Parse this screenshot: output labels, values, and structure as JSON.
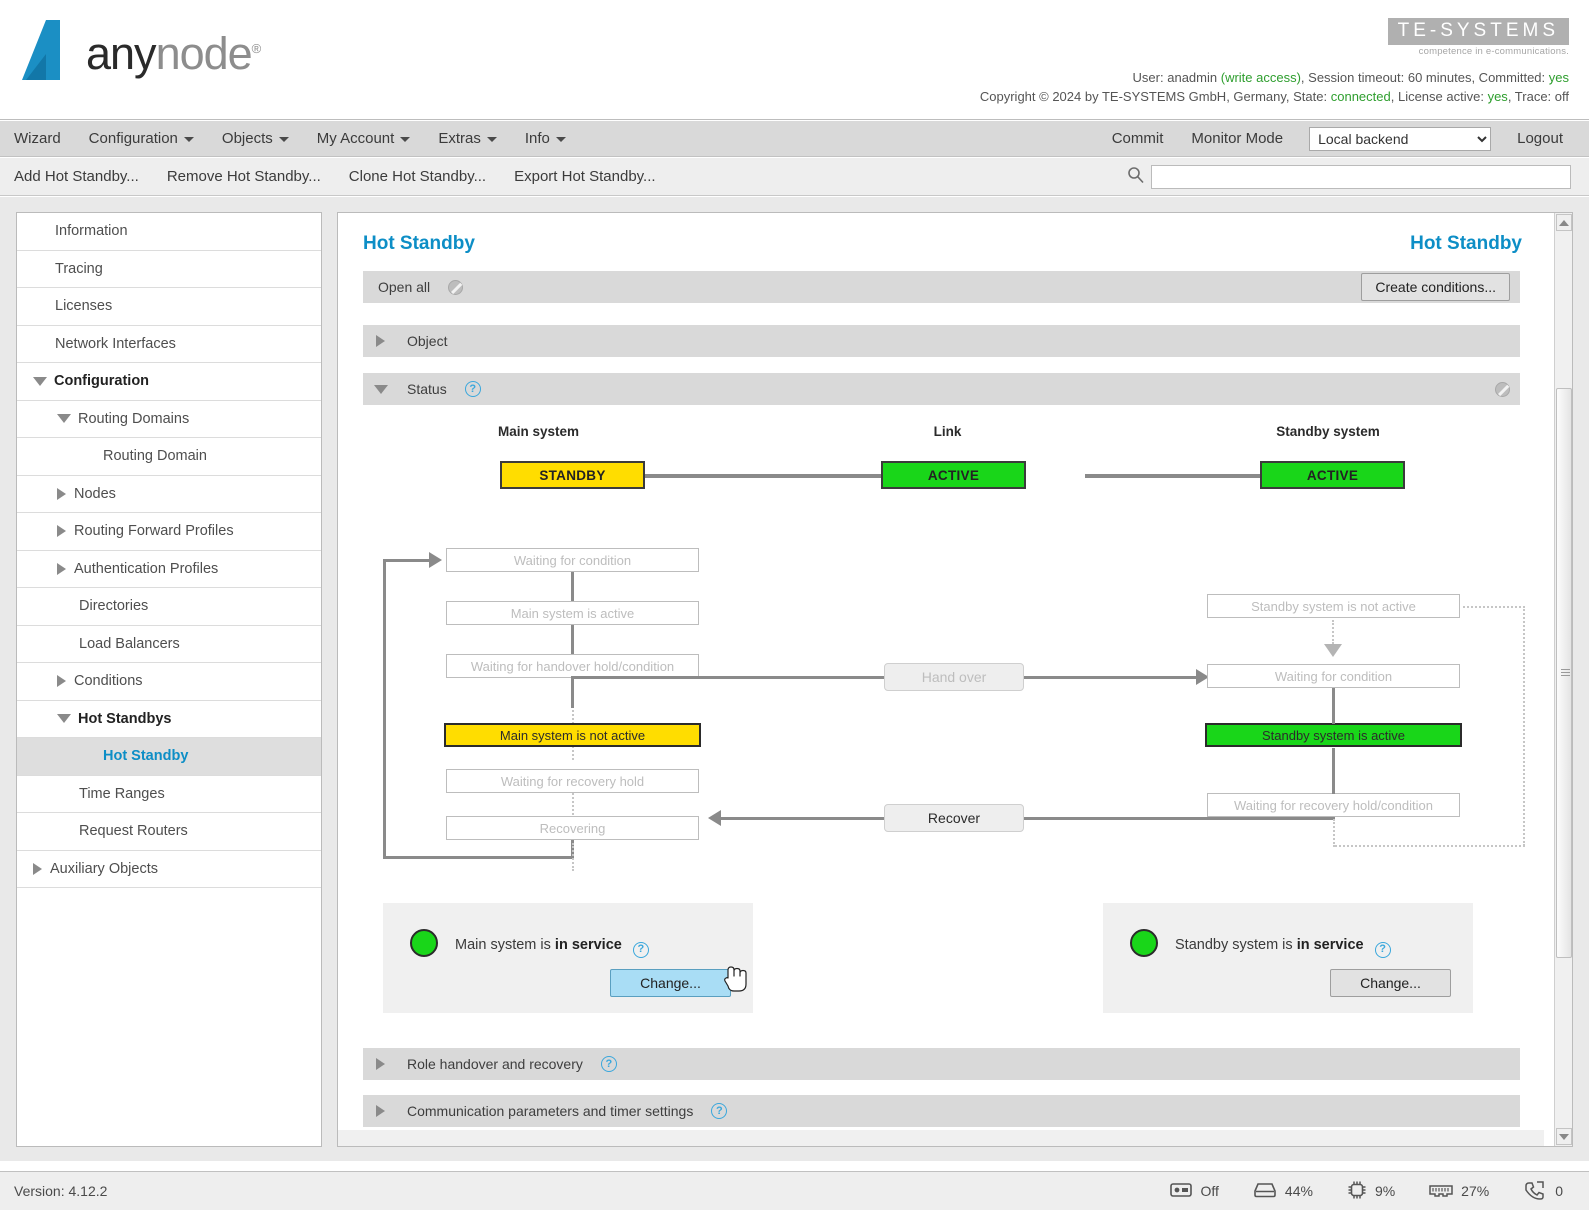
{
  "brand": {
    "logo_text_a": "any",
    "logo_text_b": "node",
    "logo_reg": "®",
    "te_name": "TE-SYSTEMS",
    "te_tagline": "competence in e-communications."
  },
  "meta": {
    "line1_user_label": "User:",
    "line1_user": "anadmin",
    "line1_access": "(write access)",
    "line1_session": ", Session timeout: 60 minutes, Committed:",
    "line1_committed": "yes",
    "line2_copyright": "Copyright © 2024 by TE-SYSTEMS GmbH, Germany, State:",
    "line2_state": "connected",
    "line2_license_label": ", License active:",
    "line2_license": "yes",
    "line2_trace": ", Trace: off"
  },
  "menubar": {
    "items": [
      {
        "label": "Wizard",
        "caret": false
      },
      {
        "label": "Configuration",
        "caret": true
      },
      {
        "label": "Objects",
        "caret": true
      },
      {
        "label": "My Account",
        "caret": true
      },
      {
        "label": "Extras",
        "caret": true
      },
      {
        "label": "Info",
        "caret": true
      }
    ],
    "commit": "Commit",
    "monitor_mode": "Monitor Mode",
    "backend_selected": "Local backend",
    "backend_options": [
      "Local backend"
    ],
    "logout": "Logout"
  },
  "actionbar": {
    "items": [
      "Add Hot Standby...",
      "Remove Hot Standby...",
      "Clone Hot Standby...",
      "Export Hot Standby..."
    ],
    "search_value": "",
    "search_placeholder": ""
  },
  "sidebar": {
    "items": [
      {
        "label": "Information",
        "indent": 0,
        "icon": "none",
        "state": "normal"
      },
      {
        "label": "Tracing",
        "indent": 0,
        "icon": "none",
        "state": "normal"
      },
      {
        "label": "Licenses",
        "indent": 0,
        "icon": "none",
        "state": "normal"
      },
      {
        "label": "Network Interfaces",
        "indent": 0,
        "icon": "none",
        "state": "normal"
      },
      {
        "label": "Configuration",
        "indent": 0,
        "icon": "down",
        "state": "bold"
      },
      {
        "label": "Routing Domains",
        "indent": 1,
        "icon": "down",
        "state": "normal"
      },
      {
        "label": "Routing Domain",
        "indent": 2,
        "icon": "none",
        "state": "normal"
      },
      {
        "label": "Nodes",
        "indent": 1,
        "icon": "right",
        "state": "normal"
      },
      {
        "label": "Routing Forward Profiles",
        "indent": 1,
        "icon": "right",
        "state": "normal"
      },
      {
        "label": "Authentication Profiles",
        "indent": 1,
        "icon": "right",
        "state": "normal"
      },
      {
        "label": "Directories",
        "indent": 1,
        "icon": "none",
        "state": "normal"
      },
      {
        "label": "Load Balancers",
        "indent": 1,
        "icon": "none",
        "state": "normal"
      },
      {
        "label": "Conditions",
        "indent": 1,
        "icon": "right",
        "state": "normal"
      },
      {
        "label": "Hot Standbys",
        "indent": 1,
        "icon": "down",
        "state": "bold"
      },
      {
        "label": "Hot Standby",
        "indent": 2,
        "icon": "none",
        "state": "selected"
      },
      {
        "label": "Time Ranges",
        "indent": 1,
        "icon": "none",
        "state": "normal"
      },
      {
        "label": "Request Routers",
        "indent": 1,
        "icon": "none",
        "state": "normal"
      },
      {
        "label": "Auxiliary Objects",
        "indent": 0,
        "icon": "right",
        "state": "normal"
      }
    ]
  },
  "main": {
    "title_left": "Hot Standby",
    "title_right": "Hot Standby",
    "open_all": "Open all",
    "create_conditions": "Create conditions...",
    "section_object": "Object",
    "section_status": "Status",
    "section_role": "Role handover and recovery",
    "section_comm": "Communication parameters and timer settings",
    "qmark": "?"
  },
  "diagram": {
    "captions": {
      "main_system": "Main system",
      "link": "Link",
      "standby_system": "Standby system"
    },
    "system_boxes": [
      {
        "label": "STANDBY",
        "color": "#ffdd00"
      },
      {
        "label": "ACTIVE",
        "color": "#19d619"
      },
      {
        "label": "ACTIVE",
        "color": "#19d619"
      }
    ],
    "left_states": [
      {
        "label": "Waiting for condition",
        "style": "inactive"
      },
      {
        "label": "Main system is active",
        "style": "inactive"
      },
      {
        "label": "Waiting for handover hold/condition",
        "style": "inactive"
      },
      {
        "label": "Main system is not active",
        "style": "yellow"
      },
      {
        "label": "Waiting for recovery hold",
        "style": "inactive"
      },
      {
        "label": "Recovering",
        "style": "inactive"
      }
    ],
    "right_states": [
      {
        "label": "Standby system is not active",
        "style": "inactive"
      },
      {
        "label": "Waiting for condition",
        "style": "inactive"
      },
      {
        "label": "Standby system is active",
        "style": "green"
      },
      {
        "label": "Waiting for recovery hold/condition",
        "style": "inactive"
      }
    ],
    "transitions": [
      {
        "label": "Hand over",
        "style": "inactive"
      },
      {
        "label": "Recover",
        "style": "active"
      }
    ]
  },
  "service_panels": {
    "main": {
      "text_prefix": "Main system is ",
      "text_bold": "in service",
      "button": "Change...",
      "led_color": "#19d619"
    },
    "standby": {
      "text_prefix": "Standby system is ",
      "text_bold": "in service",
      "button": "Change...",
      "led_color": "#19d619"
    }
  },
  "statusbar": {
    "version_label": "Version:",
    "version": "4.12.2",
    "stats": [
      {
        "icon": "trace-icon",
        "value": "Off"
      },
      {
        "icon": "disk-icon",
        "value": "44%"
      },
      {
        "icon": "cpu-icon",
        "value": "9%"
      },
      {
        "icon": "memory-icon",
        "value": "27%"
      },
      {
        "icon": "calls-icon",
        "value": "0"
      }
    ]
  },
  "colors": {
    "accent": "#0d8ec6",
    "green": "#19d619",
    "yellow": "#ffdd00",
    "text_green": "#2e9e2e"
  }
}
